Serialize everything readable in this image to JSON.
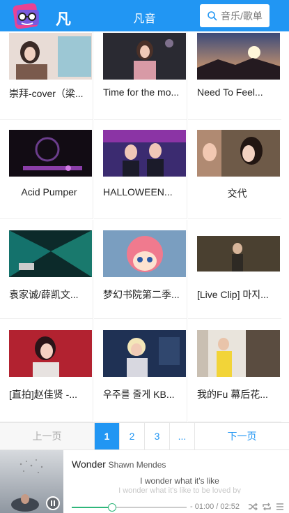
{
  "header": {
    "logo_text": "凡音",
    "title": "凡音",
    "search_placeholder": "音乐/歌单"
  },
  "videos": [
    {
      "title": "崇拜-cover（梁..."
    },
    {
      "title": "Time for the mo..."
    },
    {
      "title": "Need To Feel..."
    },
    {
      "title": "Acid Pumper"
    },
    {
      "title": "HALLOWEEN..."
    },
    {
      "title": "交代"
    },
    {
      "title": "袁家诚/薛凯文..."
    },
    {
      "title": "梦幻书院第二季..."
    },
    {
      "title": "[Live Clip] 마지..."
    },
    {
      "title": "[直拍]赵佳贤 -..."
    },
    {
      "title": "우주를 줄게 KB..."
    },
    {
      "title": "我的Fu 幕后花..."
    }
  ],
  "pagination": {
    "prev": "上一页",
    "pages": [
      "1",
      "2",
      "3",
      "..."
    ],
    "current": "1",
    "next": "下一页"
  },
  "player": {
    "song": "Wonder",
    "artist": "Shawn Mendes",
    "lyric_current": "I wonder what it's like",
    "lyric_next": "I wonder what it's like to be loved by",
    "time": "- 01:00 / 02:52",
    "progress": 0.35
  },
  "colors": {
    "primary": "#2196f3",
    "progress": "#2fb67a"
  }
}
